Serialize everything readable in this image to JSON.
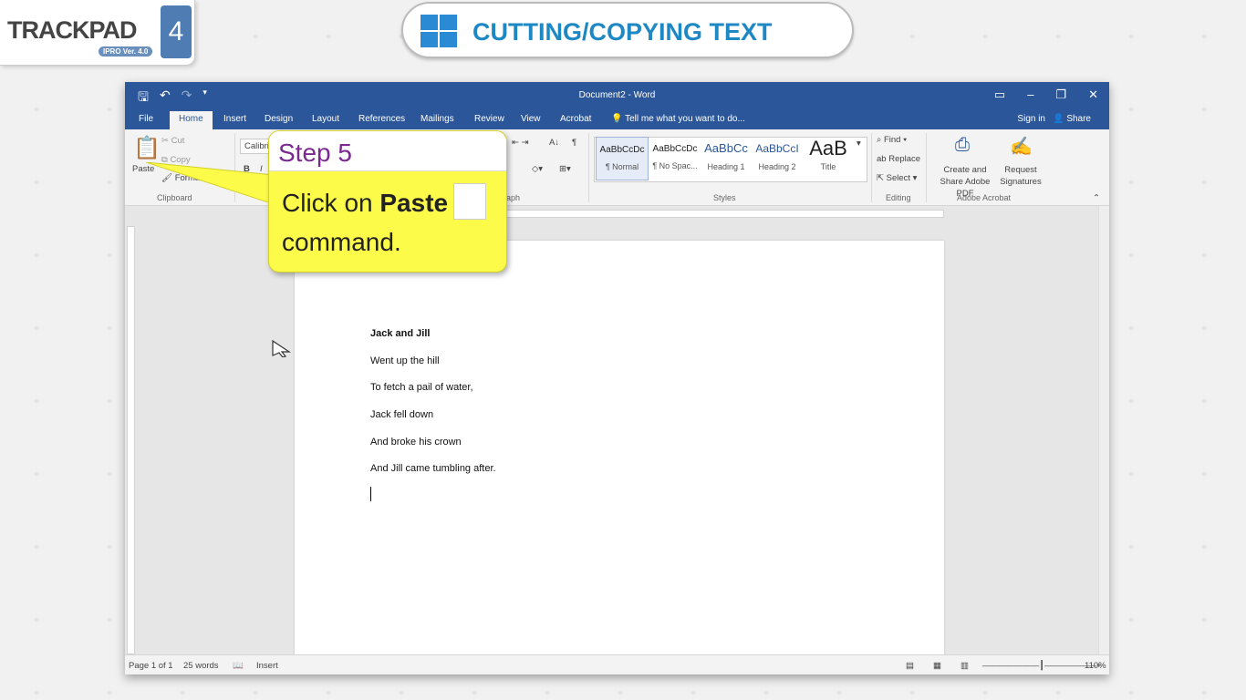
{
  "branding": {
    "logo_text": "TRACKPAD",
    "logo_version": "IPRO Ver. 4.0",
    "logo_number": "4",
    "lesson_title": "CUTTING/COPYING TEXT"
  },
  "word": {
    "document_title": "Document2 - Word",
    "tabs": [
      "File",
      "Home",
      "Insert",
      "Design",
      "Layout",
      "References",
      "Mailings",
      "Review",
      "View",
      "Acrobat"
    ],
    "tell_me": "Tell me what you want to do...",
    "sign_in": "Sign in",
    "share": "Share",
    "clipboard": {
      "paste": "Paste",
      "cut": "Cut",
      "copy": "Copy",
      "format_painter": "Format",
      "label": "Clipboard"
    },
    "font": {
      "name": "Calibri"
    },
    "paragraph_label": "aph",
    "styles": [
      {
        "preview": "AaBbCcDc",
        "name": "¶ Normal"
      },
      {
        "preview": "AaBbCcDc",
        "name": "¶ No Spac..."
      },
      {
        "preview": "AaBbCc",
        "name": "Heading 1"
      },
      {
        "preview": "AaBbCcI",
        "name": "Heading 2"
      },
      {
        "preview": "AaB",
        "name": "Title"
      }
    ],
    "styles_label": "Styles",
    "editing": {
      "find": "Find",
      "replace": "Replace",
      "select": "Select",
      "label": "Editing"
    },
    "acrobat": {
      "create_share": "Create and Share Adobe PDF",
      "request_sig": "Request Signatures",
      "label": "Adobe Acrobat"
    },
    "document_lines": [
      {
        "text": "Jack and Jill",
        "bold": true
      },
      {
        "text": "Went up the hill"
      },
      {
        "text": "To fetch a pail of water,"
      },
      {
        "text": "Jack fell down"
      },
      {
        "text": "And broke his crown"
      },
      {
        "text": "And Jill came tumbling after."
      }
    ],
    "status": {
      "page": "Page 1 of 1",
      "words": "25 words",
      "mode": "Insert",
      "zoom": "110%"
    }
  },
  "callout": {
    "step": "Step 5",
    "text_before": "Click on ",
    "text_bold": "Paste",
    "text_after": "command."
  },
  "colors": {
    "word_blue": "#2b579a",
    "callout_yellow": "#fdfb4a",
    "step_purple": "#7a2a8f",
    "brand_blue": "#1e88c4"
  }
}
